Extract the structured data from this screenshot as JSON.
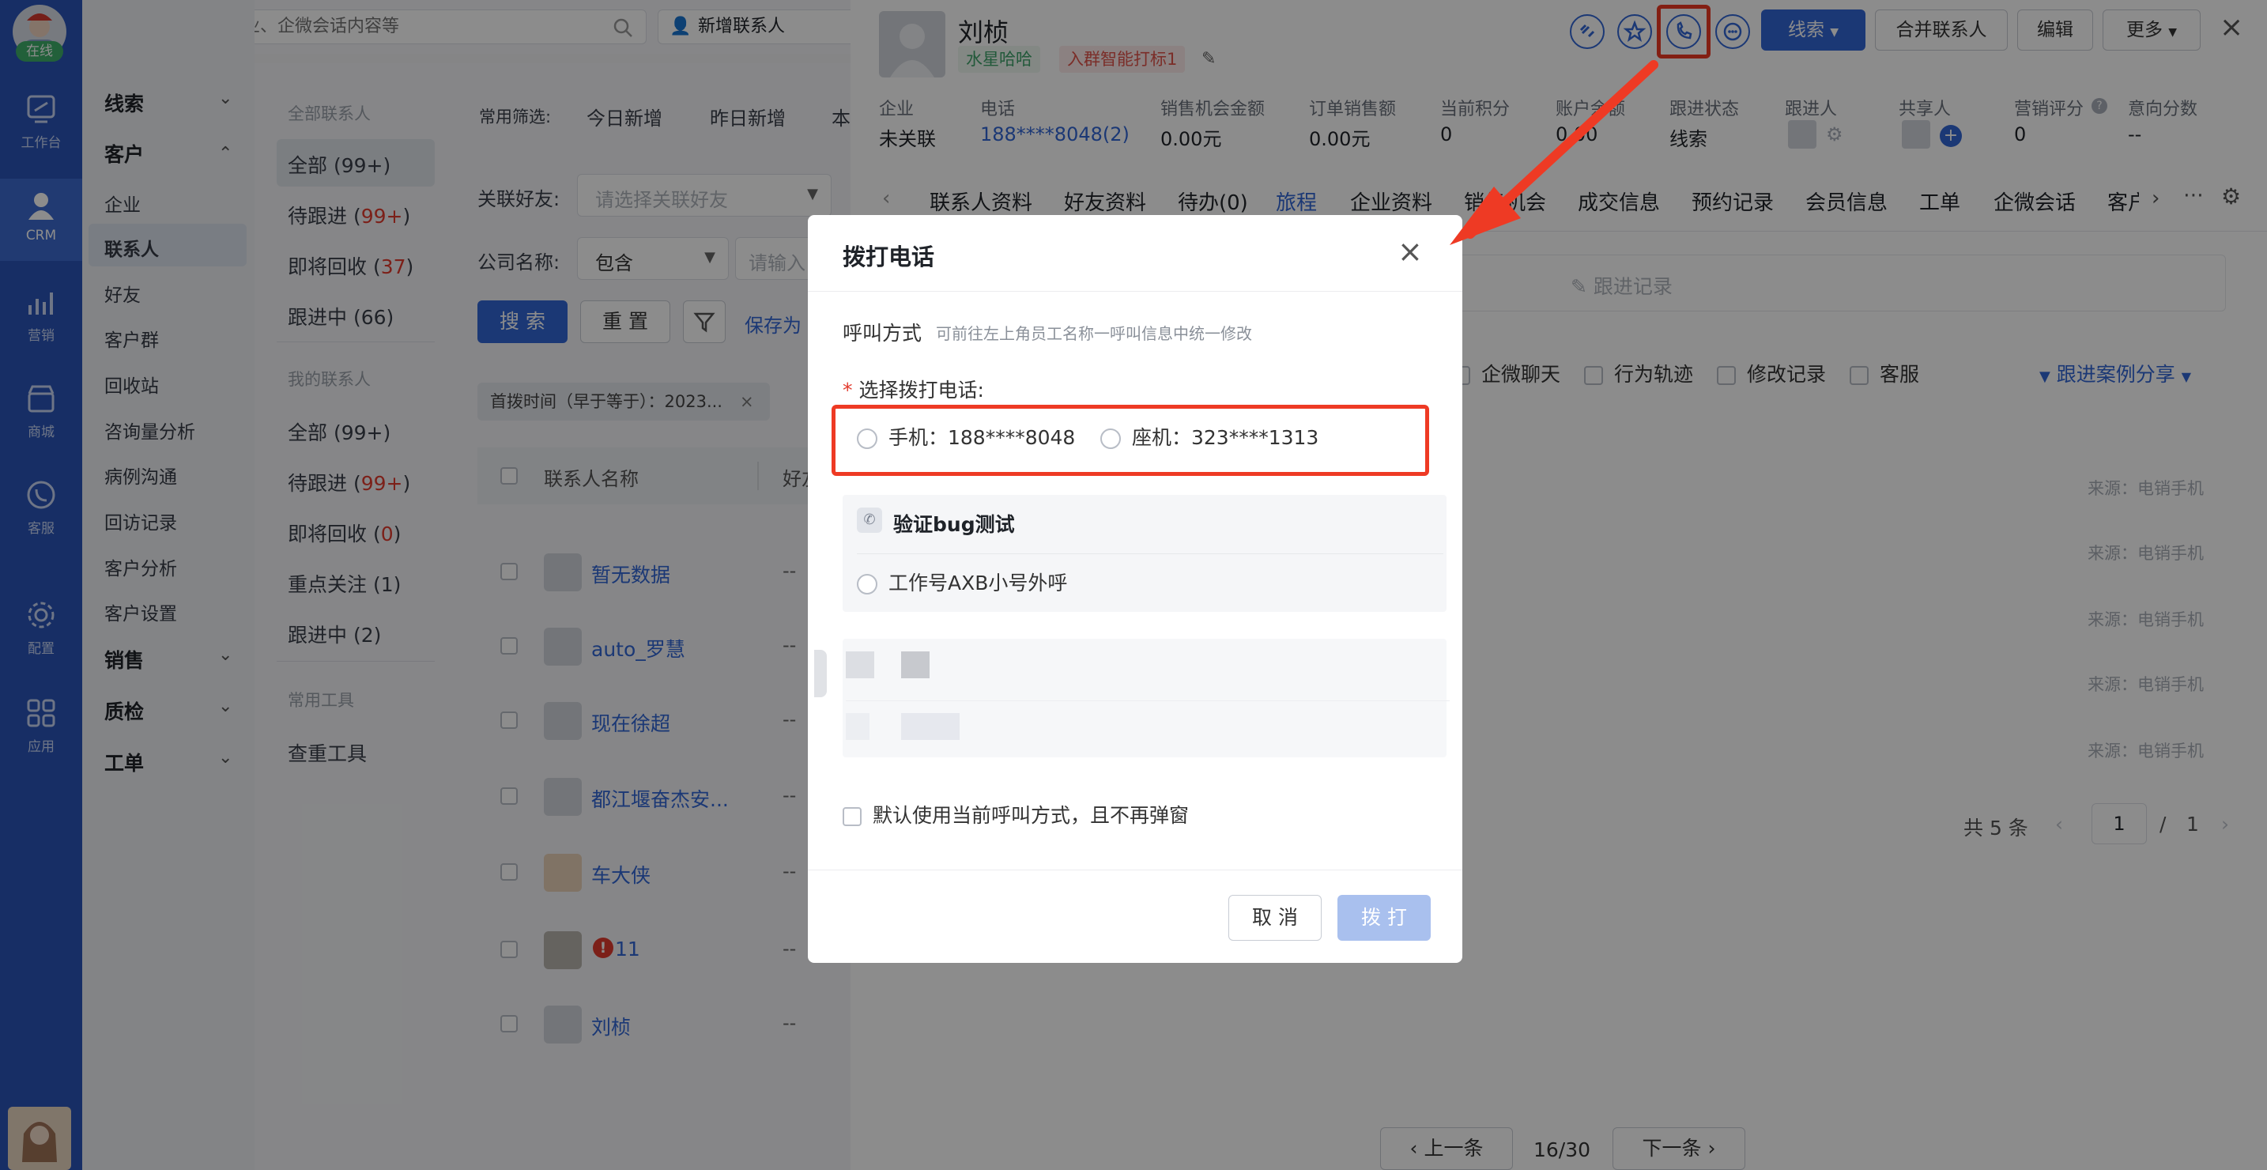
{
  "nav": {
    "status": "在线",
    "items": [
      {
        "label": "工作台"
      },
      {
        "label": "CRM"
      },
      {
        "label": "营销"
      },
      {
        "label": "商城"
      },
      {
        "label": "客服"
      },
      {
        "label": "配置"
      },
      {
        "label": "应用"
      }
    ]
  },
  "search": {
    "placeholder": "搜索联系人、企业、企微会话内容等"
  },
  "toolbar": {
    "add_contact": "新增联系人"
  },
  "sidebar": {
    "clue": "线索",
    "customer": "客户",
    "items": [
      "企业",
      "联系人",
      "好友",
      "客户群",
      "回收站",
      "咨询量分析",
      "病例沟通",
      "回访记录",
      "客户分析",
      "客户设置"
    ],
    "sales": "销售",
    "quality": "质检",
    "workorder": "工单"
  },
  "subfilter": {
    "all_title": "全部联系人",
    "all": "全部 (99+)",
    "pending_prefix": "待跟进 (",
    "pending_count": "99+",
    "pending_suffix": ")",
    "recycle_prefix": "即将回收 (",
    "recycle_count": "37",
    "recycle_suffix": ")",
    "following": "跟进中 (66)",
    "mine_title": "我的联系人",
    "my_all": "全部 (99+)",
    "my_pending_prefix": "待跟进 (",
    "my_pending_count": "99+",
    "my_pending_suffix": ")",
    "my_recycle_prefix": "即将回收 (",
    "my_recycle_count": "0",
    "my_recycle_suffix": ")",
    "focus": "重点关注 (1)",
    "my_following": "跟进中 (2)",
    "tools_title": "常用工具",
    "dup_tool": "查重工具"
  },
  "list": {
    "common_filter": "常用筛选:",
    "today_new": "今日新增",
    "yesterday_new": "昨日新增",
    "this_more": "本",
    "friend_label": "关联好友:",
    "friend_placeholder": "请选择关联好友",
    "company_label": "公司名称:",
    "company_op": "包含",
    "company_placeholder": "请输入",
    "search_btn": "搜 索",
    "reset_btn": "重 置",
    "save_as": "保存为",
    "filter_tag": "首拨时间（早于等于）：2023...",
    "col_name": "联系人名称",
    "col_friend": "好友",
    "rows": [
      {
        "name": "暂无数据",
        "friend": "--"
      },
      {
        "name": "auto_罗慧",
        "friend": "--"
      },
      {
        "name": "现在徐超",
        "friend": "--"
      },
      {
        "name": "都江堰奋杰安...",
        "friend": "--"
      },
      {
        "name": "车大侠",
        "friend": "--"
      },
      {
        "name": "11",
        "friend": "--"
      },
      {
        "name": "刘桢",
        "friend": "--"
      }
    ]
  },
  "detail": {
    "name": "刘桢",
    "tag1": "水星哈哈",
    "tag2": "入群智能打标1",
    "btn_clue": "线索",
    "btn_merge": "合并联系人",
    "btn_edit": "编辑",
    "btn_more": "更多",
    "fields": [
      {
        "key": "企业",
        "value": "未关联"
      },
      {
        "key": "电话",
        "value": "188****8048(2)"
      },
      {
        "key": "销售机会金额",
        "value": "0.00元"
      },
      {
        "key": "订单销售额",
        "value": "0.00元"
      },
      {
        "key": "当前积分",
        "value": "0"
      },
      {
        "key": "账户余额",
        "value": "0.00"
      },
      {
        "key": "跟进状态",
        "value": "线索"
      },
      {
        "key": "跟进人",
        "value": ""
      },
      {
        "key": "共享人",
        "value": ""
      },
      {
        "key": "营销评分",
        "value": "0"
      },
      {
        "key": "意向分数",
        "value": "--"
      }
    ],
    "tabs": [
      "联系人资料",
      "好友资料",
      "待办(0)",
      "旅程",
      "企业资料",
      "销售机会",
      "成交信息",
      "预约记录",
      "会员信息",
      "工单",
      "企微会话",
      "客户"
    ],
    "follow_record": "跟进记录",
    "checks": [
      "企微聊天",
      "行为轨迹",
      "修改记录",
      "客服"
    ],
    "share": "跟进案例分享",
    "source": "来源：电销手机",
    "pagination": {
      "total": "共 5 条",
      "page": "1",
      "sep": "/",
      "pages": "1"
    },
    "prev": "上一条",
    "pos": "16/30",
    "next": "下一条"
  },
  "dialog": {
    "title": "拨打电话",
    "call_mode": "呼叫方式",
    "call_hint": "可前往左上角员工名称一呼叫信息中统一修改",
    "select_label": "选择拨打电话:",
    "mobile": "手机：188****8048",
    "landline": "座机：323****1313",
    "section": "验证bug测试",
    "axb": "工作号AXB小号外呼",
    "default_check": "默认使用当前呼叫方式，且不再弹窗",
    "cancel": "取 消",
    "dial": "拨 打"
  }
}
